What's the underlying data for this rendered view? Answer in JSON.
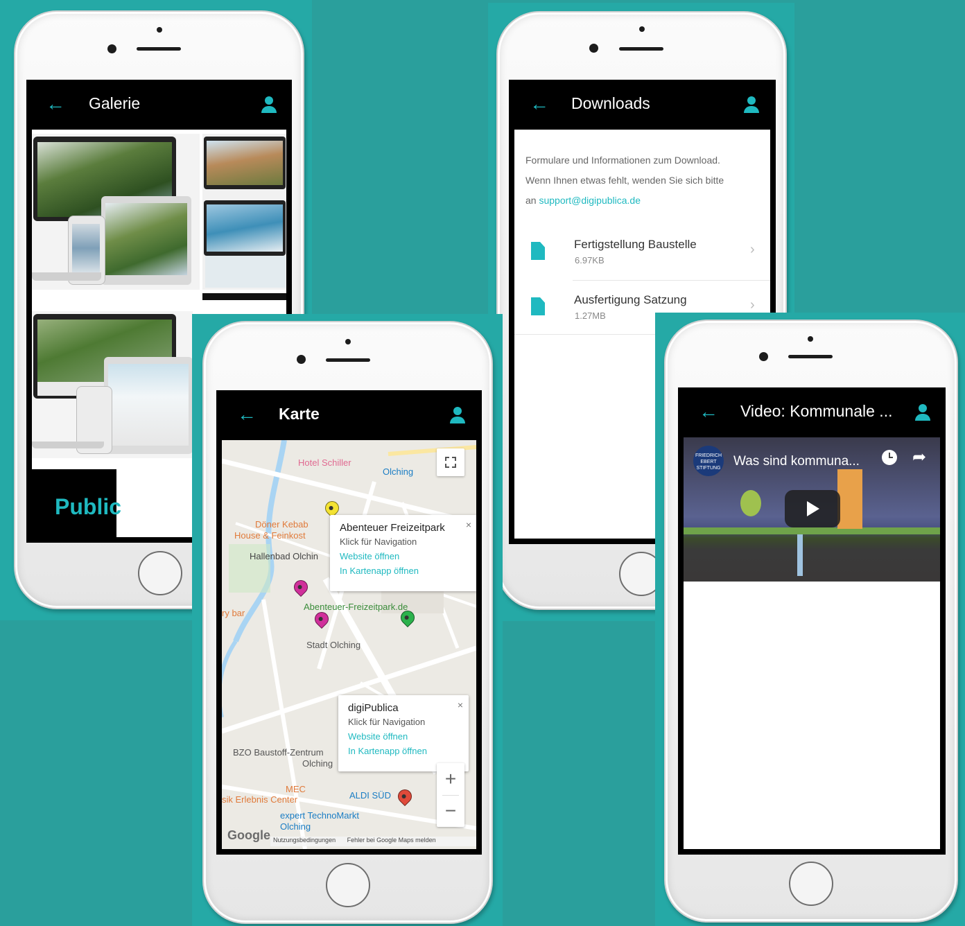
{
  "colors": {
    "background": "#2a9f9c",
    "accent": "#1fb9c0",
    "appbar": "#000000"
  },
  "galerie": {
    "title": "Galerie",
    "partial_text": "Public",
    "icons": {
      "back": "arrow-left-icon",
      "user": "user-icon"
    }
  },
  "downloads": {
    "title": "Downloads",
    "intro_line1": "Formulare und Informationen zum Download.",
    "intro_line2": "Wenn Ihnen etwas fehlt, wenden Sie sich bitte",
    "intro_prefix": "an",
    "email": "support@digipublica.de",
    "files": [
      {
        "name": "Fertigstellung Baustelle",
        "size": "6.97KB"
      },
      {
        "name": "Ausfertigung Satzung",
        "size": "1.27MB"
      }
    ]
  },
  "karte": {
    "title": "Karte",
    "labels": {
      "hotel": "Hotel Schiller",
      "olching": "Olching",
      "doener1": "Döner Kebab",
      "doener2": "House & Feinkost",
      "hallenbad": "Hallenbad Olchin",
      "freizeit": "Abenteuer-Freizeitpark.de",
      "bar": "ry bar",
      "stadt": "Stadt Olching",
      "bzo1": "BZO Baustoff-Zentrum",
      "bzo2": "Olching",
      "mec": "MEC",
      "erlebnis": "sik Erlebnis Center",
      "aldi": "ALDI SÜD",
      "expert1": "expert TechnoMarkt",
      "expert2": "Olching",
      "google": "Google",
      "terms": "Nutzungsbedingungen",
      "report": "Fehler bei Google Maps melden"
    },
    "infowindow1": {
      "title": "Abenteuer Freizeitpark",
      "subtitle": "Klick für Navigation",
      "link1": "Website öffnen",
      "link2": "In Kartenapp öffnen",
      "close": "×"
    },
    "infowindow2": {
      "title": "digiPublica",
      "subtitle": "Klick für Navigation",
      "link1": "Website öffnen",
      "link2": "In Kartenapp öffnen",
      "close": "×"
    },
    "zoom_in": "+",
    "zoom_out": "−"
  },
  "video": {
    "title": "Video: Kommunale ...",
    "video_title": "Was sind kommuna...",
    "channel": "FRIEDRICH EBERT STIFTUNG"
  }
}
